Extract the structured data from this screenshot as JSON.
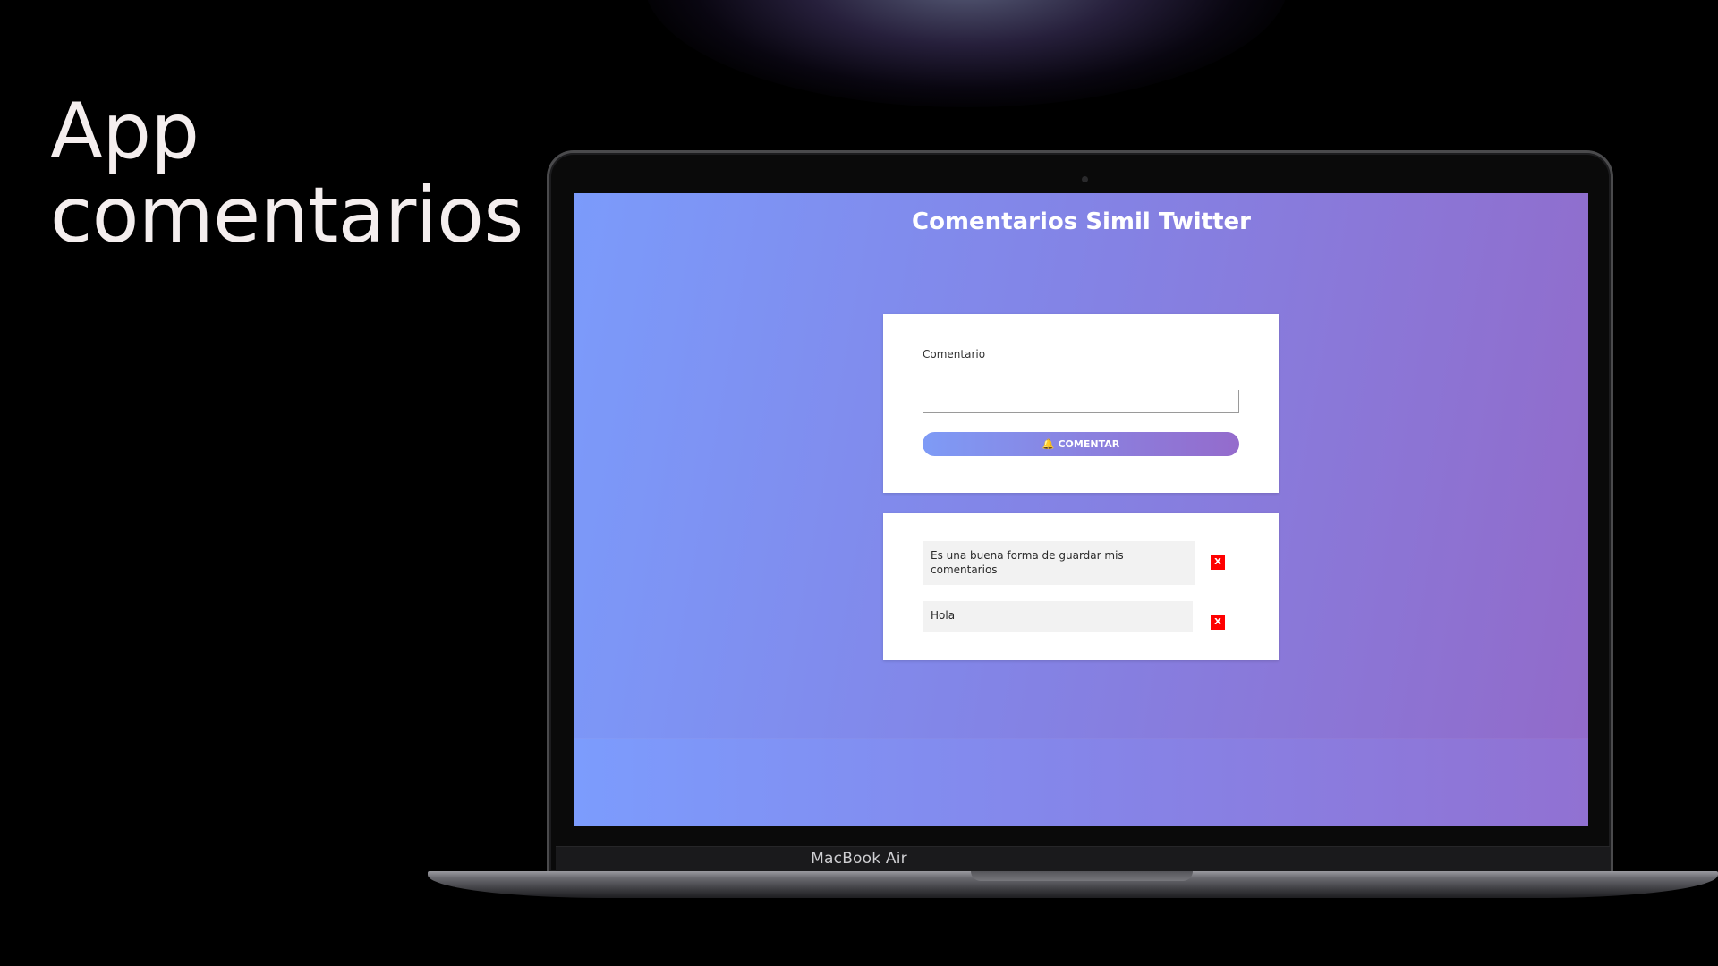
{
  "promo": {
    "headline_line1": "App",
    "headline_line2": "comentarios"
  },
  "device": {
    "model_label": "MacBook Air"
  },
  "app": {
    "title": "Comentarios Simil Twitter",
    "form": {
      "label": "Comentario",
      "input_value": "",
      "input_placeholder": "",
      "submit_icon": "bell-icon",
      "submit_label": "COMENTAR"
    },
    "comments": [
      {
        "text": "Es una buena forma de guardar mis comentarios",
        "delete_label": "X"
      },
      {
        "text": "Hola",
        "delete_label": "X"
      }
    ],
    "colors": {
      "gradient_start": "#7b9bfb",
      "gradient_end": "#926ac9",
      "delete_button": "#ff0000",
      "comment_background": "#f2f2f2"
    }
  }
}
